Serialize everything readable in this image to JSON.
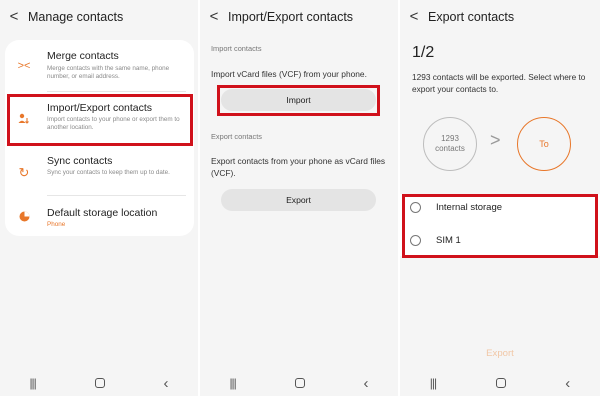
{
  "nav": {
    "recent_icon": "|||",
    "back_icon": "‹"
  },
  "panel1": {
    "title": "Manage contacts",
    "items": [
      {
        "label": "Merge contacts",
        "sub": "Merge contacts with the same name, phone number, or email address.",
        "icon": "merge-icon"
      },
      {
        "label": "Import/Export contacts",
        "sub": "Import contacts to your phone or export them to another location.",
        "icon": "import-export-icon"
      },
      {
        "label": "Sync contacts",
        "sub": "Sync your contacts to keep them up to date.",
        "icon": "sync-icon"
      },
      {
        "label": "Default storage location",
        "sub": "Phone",
        "icon": "storage-icon"
      }
    ]
  },
  "panel2": {
    "title": "Import/Export contacts",
    "import_section": "Import contacts",
    "import_desc": "Import vCard files (VCF) from your phone.",
    "import_button": "Import",
    "export_section": "Export contacts",
    "export_desc": "Export contacts from your phone as vCard files (VCF).",
    "export_button": "Export"
  },
  "panel3": {
    "title": "Export contacts",
    "step": "1/2",
    "desc": "1293 contacts will be exported. Select where to export your contacts to.",
    "from_count": "1293",
    "from_label": "contacts",
    "to_label": "To",
    "options": [
      "Internal storage",
      "SIM 1"
    ],
    "export_button": "Export"
  },
  "colors": {
    "accent": "#e8772a",
    "highlight": "#d0111b",
    "background": "#f5f5f5"
  }
}
